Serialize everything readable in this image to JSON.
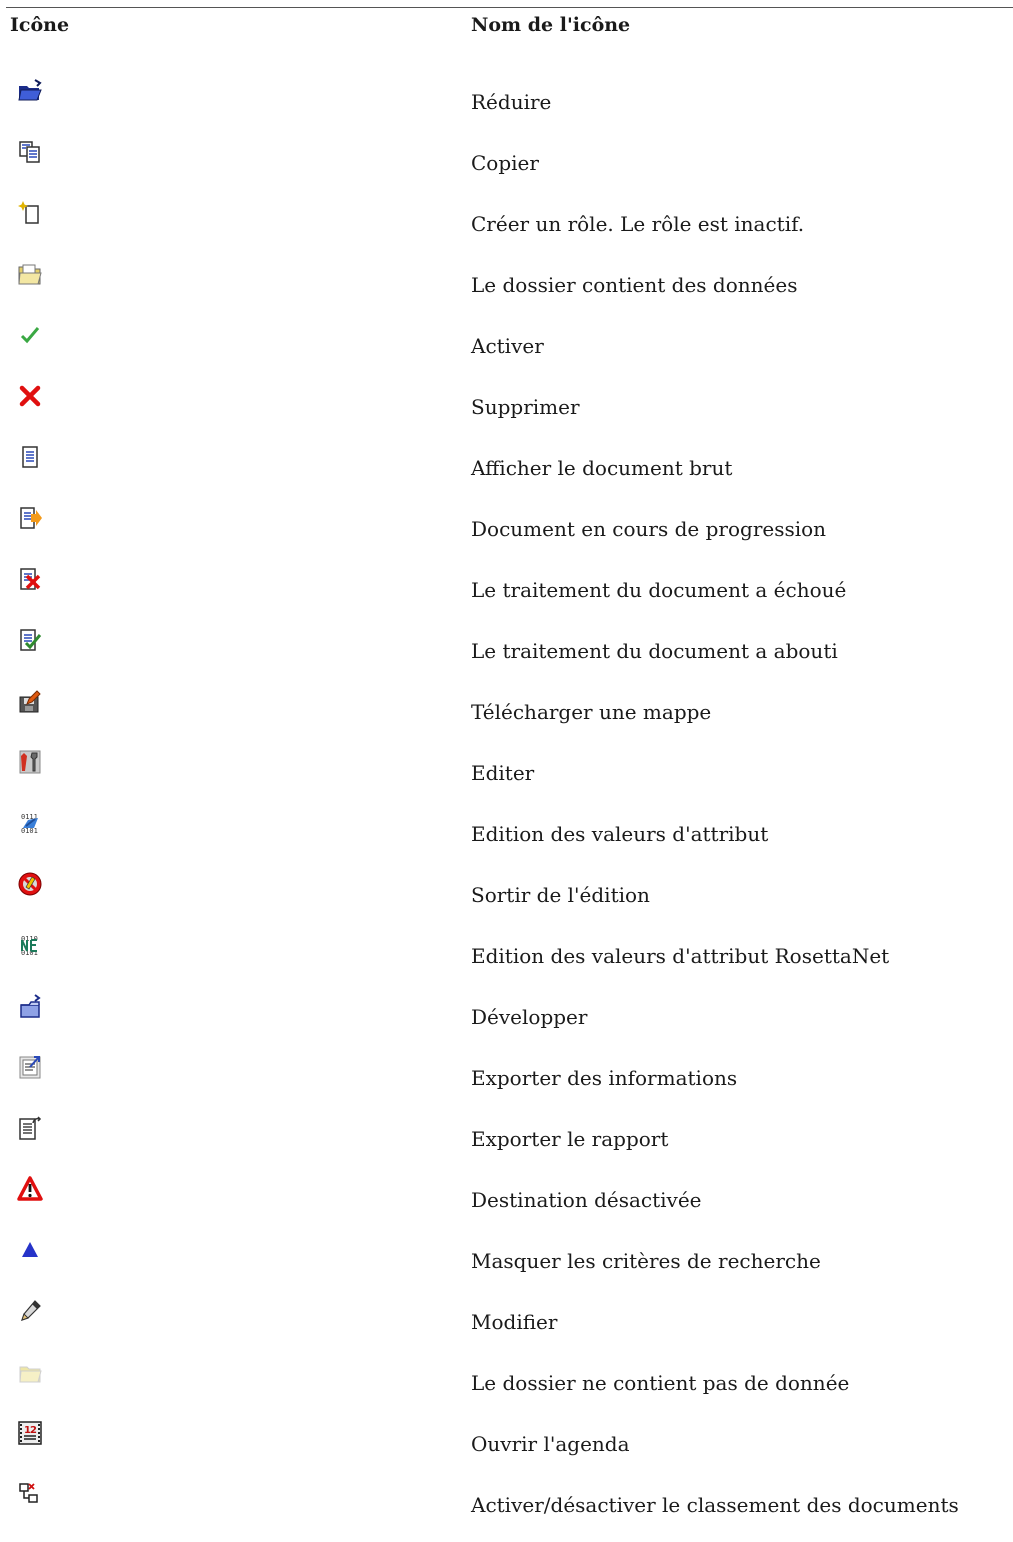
{
  "header": {
    "icon_col": "Icône",
    "name_col": "Nom de l'icône"
  },
  "rows": [
    {
      "icon": "folder-open-icon",
      "name": "Réduire"
    },
    {
      "icon": "copy-icon",
      "name": "Copier"
    },
    {
      "icon": "new-document-icon",
      "name": "Créer un rôle. Le rôle est inactif."
    },
    {
      "icon": "folder-with-data-icon",
      "name": "Le dossier contient des données"
    },
    {
      "icon": "checkmark-icon",
      "name": "Activer"
    },
    {
      "icon": "delete-x-icon",
      "name": "Supprimer"
    },
    {
      "icon": "document-icon",
      "name": "Afficher le document brut"
    },
    {
      "icon": "document-in-progress-icon",
      "name": "Document en cours de progression"
    },
    {
      "icon": "document-failed-icon",
      "name": "Le traitement du document a échoué"
    },
    {
      "icon": "document-success-icon",
      "name": "Le traitement du document a abouti"
    },
    {
      "icon": "download-map-icon",
      "name": "Télécharger une mappe"
    },
    {
      "icon": "edit-tools-icon",
      "name": "Editer"
    },
    {
      "icon": "binary-attribute-icon",
      "name": "Edition des valeurs d'attribut"
    },
    {
      "icon": "exit-edit-icon",
      "name": "Sortir de l'édition"
    },
    {
      "icon": "rosettanet-attribute-icon",
      "name": "Edition des valeurs d'attribut RosettaNet"
    },
    {
      "icon": "expand-folder-icon",
      "name": "Développer"
    },
    {
      "icon": "export-info-icon",
      "name": "Exporter des informations"
    },
    {
      "icon": "export-report-icon",
      "name": "Exporter le rapport"
    },
    {
      "icon": "warning-icon",
      "name": "Destination désactivée"
    },
    {
      "icon": "triangle-up-icon",
      "name": "Masquer les critères de recherche"
    },
    {
      "icon": "pencil-icon",
      "name": "Modifier"
    },
    {
      "icon": "empty-folder-icon",
      "name": "Le dossier ne contient pas de donnée"
    },
    {
      "icon": "calendar-icon",
      "name": "Ouvrir l'agenda"
    },
    {
      "icon": "sort-toggle-icon",
      "name": "Activer/désactiver le classement des documents"
    }
  ]
}
